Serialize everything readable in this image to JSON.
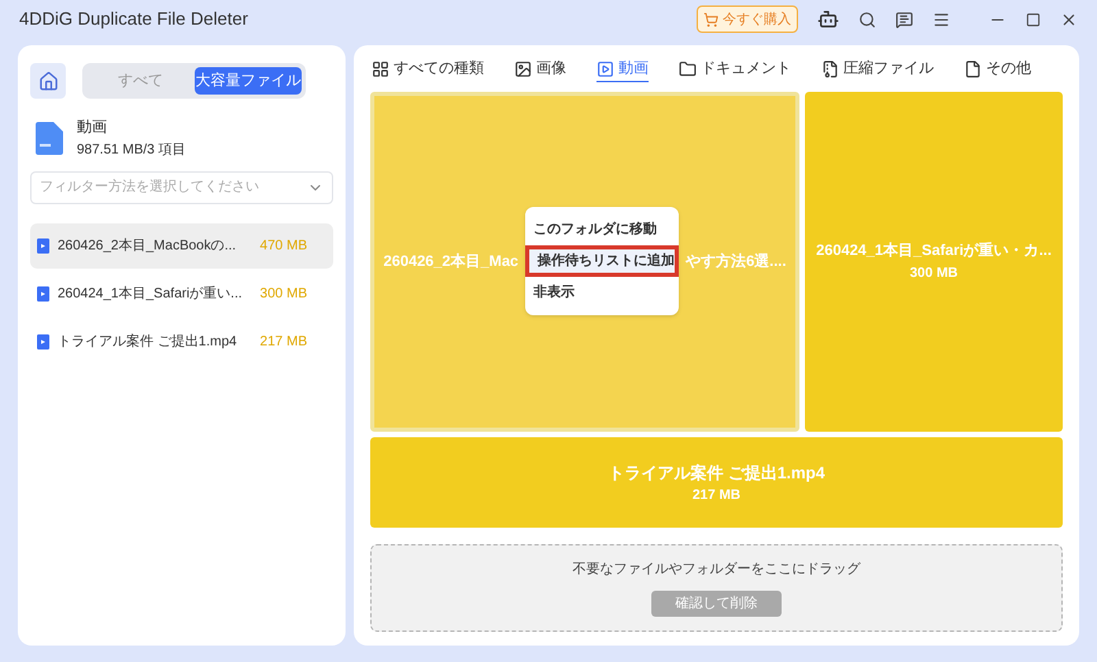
{
  "window": {
    "title": "4DDiG Duplicate File Deleter",
    "buy_button": "今すぐ購入"
  },
  "sidebar": {
    "segments": [
      {
        "label": "すべて",
        "selected": false
      },
      {
        "label": "大容量ファイル",
        "selected": true
      }
    ],
    "category": {
      "name": "動画",
      "summary": "987.51 MB/3 項目"
    },
    "filter": {
      "placeholder": "フィルター方法を選択してください"
    },
    "files": [
      {
        "name": "260426_2本目_MacBookの...",
        "size": "470 MB",
        "selected": true
      },
      {
        "name": "260424_1本目_Safariが重い...",
        "size": "300 MB",
        "selected": false
      },
      {
        "name": "トライアル案件 ご提出1.mp4",
        "size": "217 MB",
        "selected": false
      }
    ]
  },
  "tabs": [
    {
      "label": "すべての種類",
      "kind": "grid",
      "selected": false
    },
    {
      "label": "画像",
      "kind": "image",
      "selected": false
    },
    {
      "label": "動画",
      "kind": "video",
      "selected": true
    },
    {
      "label": "ドキュメント",
      "kind": "folder",
      "selected": false
    },
    {
      "label": "圧縮ファイル",
      "kind": "zip",
      "selected": false
    },
    {
      "label": "その他",
      "kind": "file",
      "selected": false
    }
  ],
  "treemap": {
    "large_tile": {
      "name_left": "260426_2本目_Mac",
      "name_right": "やす方法6選....",
      "selected": true
    },
    "side_tile": {
      "name": "260424_1本目_Safariが重い・カ...",
      "size": "300 MB",
      "selected": false
    },
    "bottom_tile": {
      "name": "トライアル案件 ご提出1.mp4",
      "size": "217 MB",
      "selected": false
    }
  },
  "context_menu": [
    {
      "label": "このフォルダに移動",
      "highlighted": false
    },
    {
      "label": "操作待ちリストに追加",
      "highlighted": true
    },
    {
      "label": "非表示",
      "highlighted": false
    }
  ],
  "drop_zone": {
    "hint": "不要なファイルやフォルダーをここにドラッグ",
    "button": "確認して削除",
    "disabled": true
  }
}
